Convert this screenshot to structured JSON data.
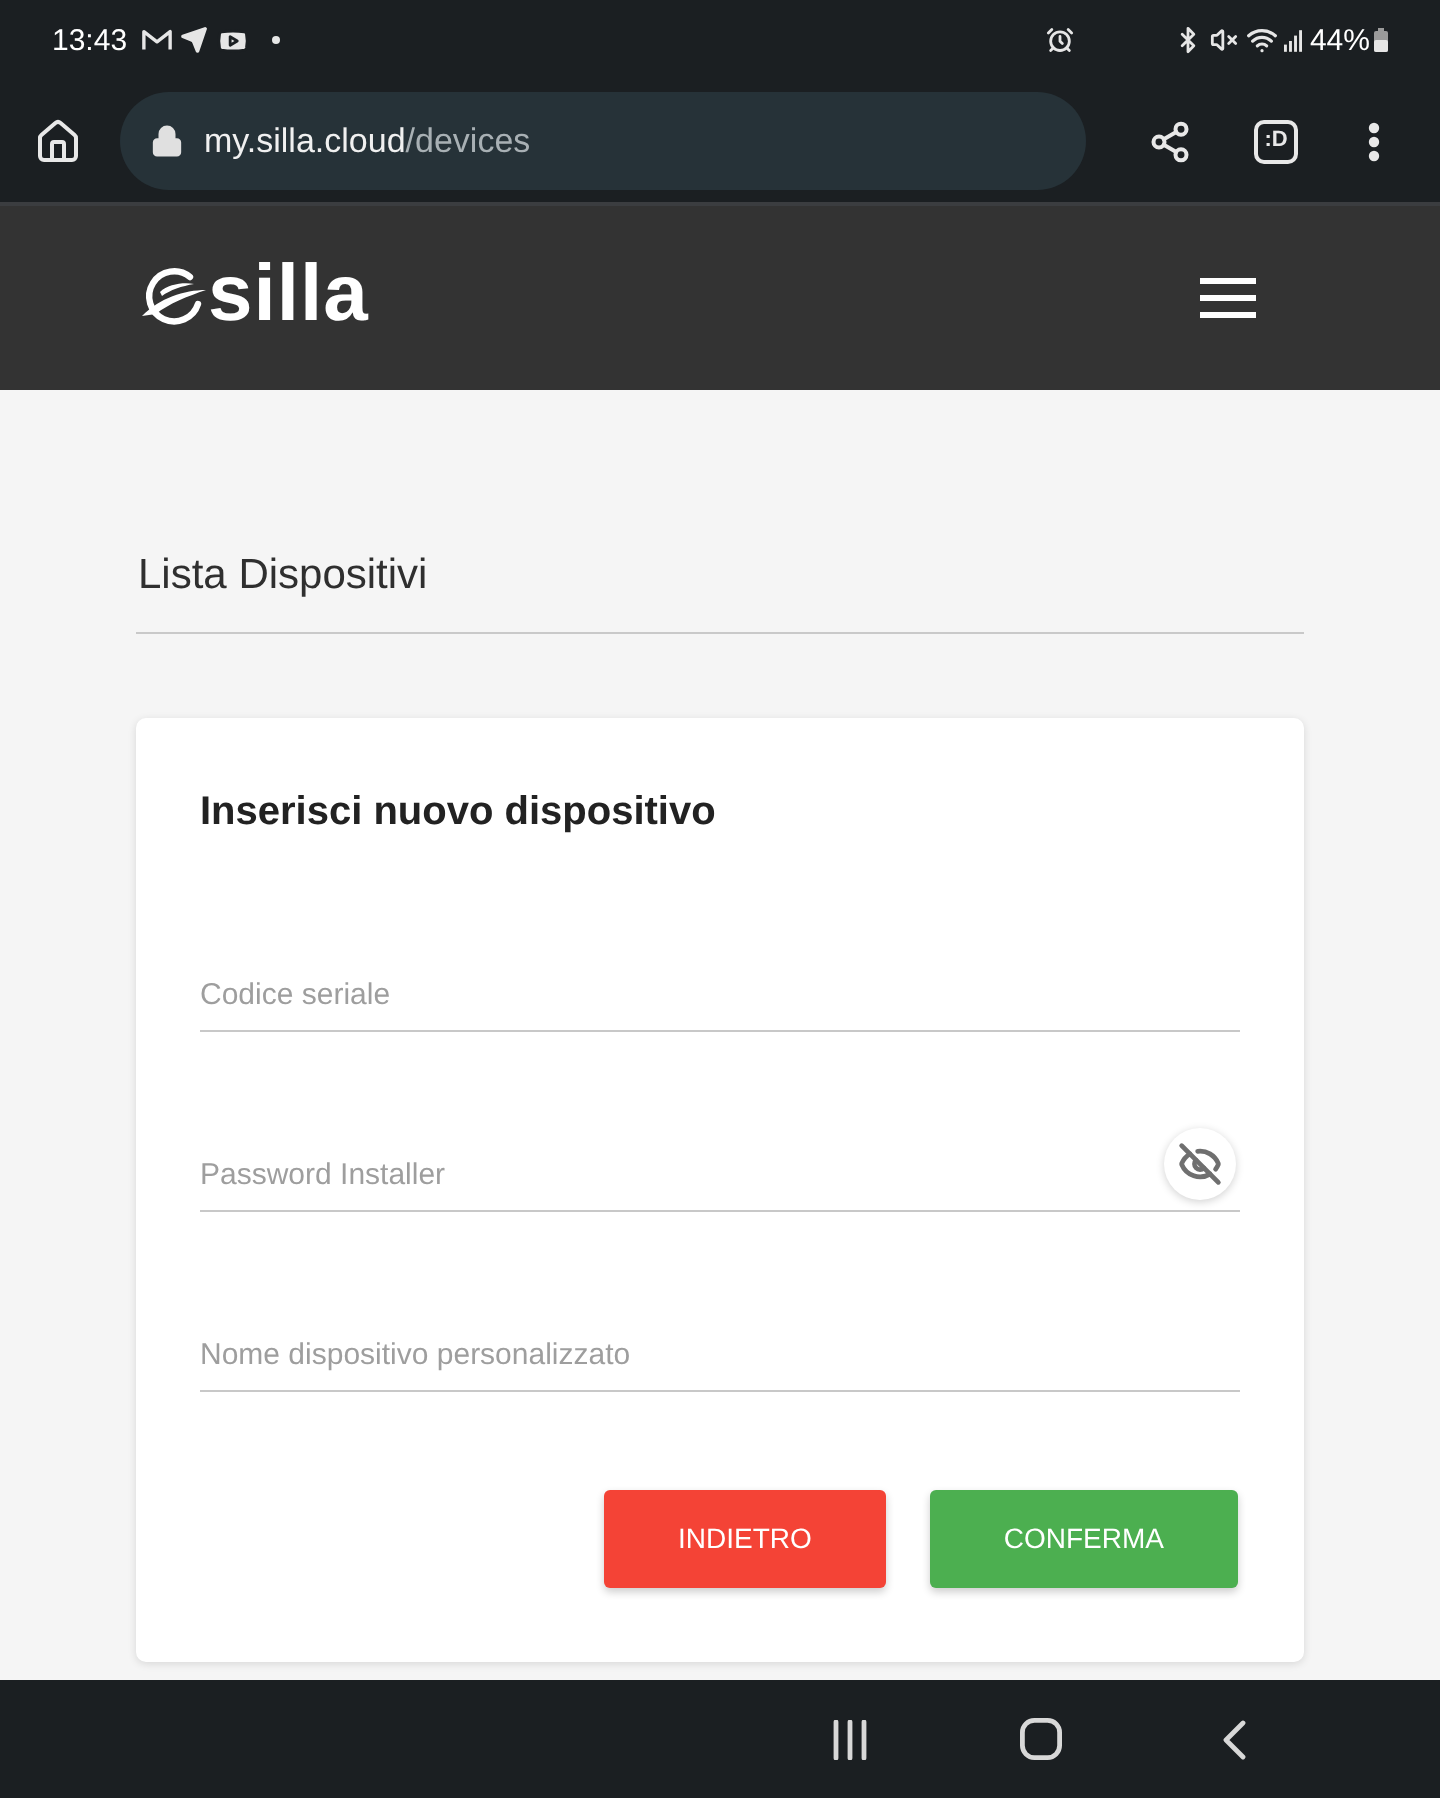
{
  "status_bar": {
    "time": "13:43",
    "battery": "44%"
  },
  "browser": {
    "url_host": "my.silla.cloud",
    "url_path": "/devices",
    "tab_count": ":D"
  },
  "header": {
    "logo": "silla"
  },
  "page": {
    "title": "Lista Dispositivi"
  },
  "form": {
    "title": "Inserisci nuovo dispositivo",
    "fields": [
      {
        "kind": "text",
        "placeholder": "Codice seriale"
      },
      {
        "kind": "password",
        "placeholder": "Password Installer"
      },
      {
        "kind": "text",
        "placeholder": "Nome dispositivo personalizzato"
      }
    ],
    "buttons": [
      {
        "kind": "back",
        "label": "INDIETRO"
      },
      {
        "kind": "confirm",
        "label": "CONFERMA"
      }
    ]
  }
}
